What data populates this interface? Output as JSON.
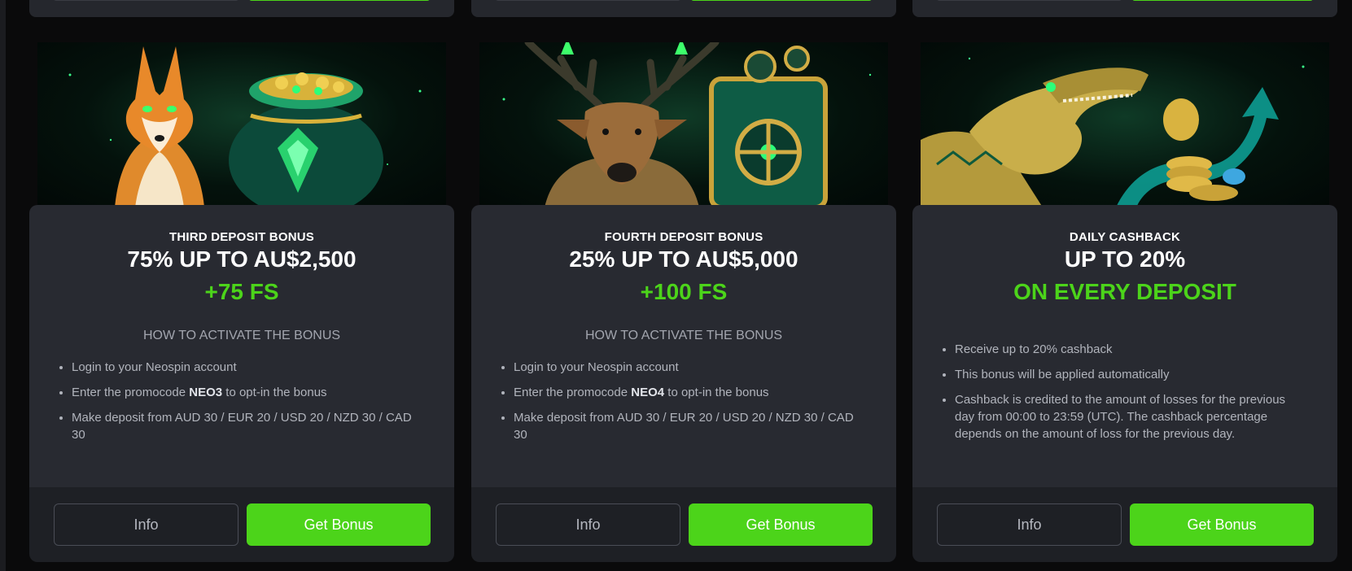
{
  "cards": [
    {
      "subtitle": "THIRD DEPOSIT BONUS",
      "headline": "75% UP TO AU$2,500",
      "extra": "+75 FS",
      "howto": "HOW TO ACTIVATE THE BONUS",
      "steps": [
        {
          "before": "Login to your Neospin account",
          "code": "",
          "after": ""
        },
        {
          "before": "Enter the promocode ",
          "code": "NEO3",
          "after": " to opt-in the bonus"
        },
        {
          "before": "Make deposit from AUD 30 / EUR 20 / USD 20 / NZD 30 / CAD 30",
          "code": "",
          "after": ""
        }
      ],
      "info_label": "Info",
      "bonus_label": "Get Bonus"
    },
    {
      "subtitle": "FOURTH DEPOSIT BONUS",
      "headline": "25% UP TO AU$5,000",
      "extra": "+100 FS",
      "howto": "HOW TO ACTIVATE THE BONUS",
      "steps": [
        {
          "before": "Login to your Neospin account",
          "code": "",
          "after": ""
        },
        {
          "before": "Enter the promocode ",
          "code": "NEO4",
          "after": " to opt-in the bonus"
        },
        {
          "before": "Make deposit from AUD 30 / EUR 20 / USD 20 / NZD 30 / CAD 30",
          "code": "",
          "after": ""
        }
      ],
      "info_label": "Info",
      "bonus_label": "Get Bonus"
    },
    {
      "subtitle": "DAILY CASHBACK",
      "headline": "UP TO 20%",
      "extra": "ON EVERY DEPOSIT",
      "steps": [
        {
          "before": "Receive up to 20% cashback",
          "code": "",
          "after": ""
        },
        {
          "before": "This bonus will be applied automatically",
          "code": "",
          "after": ""
        },
        {
          "before": "Cashback is credited to the amount of losses for the previous day from 00:00 to 23:59 (UTC). The cashback percentage depends on the amount of loss for the previous day.",
          "code": "",
          "after": ""
        }
      ],
      "info_label": "Info",
      "bonus_label": "Get Bonus"
    }
  ],
  "colors": {
    "accent": "#4cd41a",
    "panel": "#282a31",
    "footer": "#1e2025",
    "page": "#0a0a0b"
  },
  "illustrations": [
    "fox-with-treasure-bag",
    "deer-with-safe",
    "crocodile-with-coins"
  ]
}
